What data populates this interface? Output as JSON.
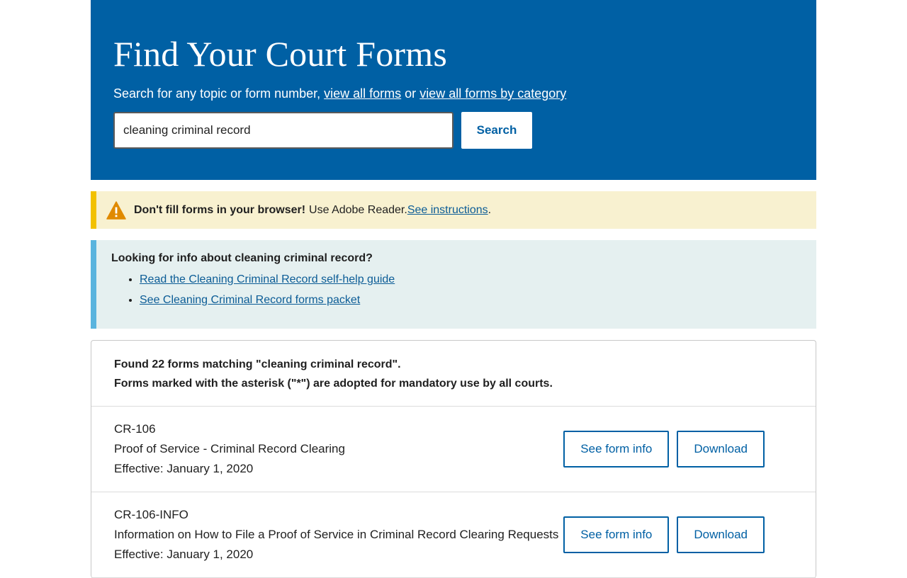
{
  "hero": {
    "title": "Find Your Court Forms",
    "subtitle_text": "Search for any topic or form number, ",
    "link_all_forms": "view all forms",
    "or_text": " or ",
    "link_by_category": "view all forms by category",
    "search_value": "cleaning criminal record",
    "search_button": "Search"
  },
  "alert": {
    "icon": "warning-icon",
    "bold": "Don't fill forms in your browser!",
    "text": "Use Adobe Reader. ",
    "link": "See instructions",
    "end": ".",
    "accent": "#f2c100"
  },
  "info": {
    "question": "Looking for info about cleaning criminal record?",
    "links": [
      "Read the Cleaning Criminal Record self-help guide",
      "See Cleaning Criminal Record forms packet"
    ]
  },
  "results": {
    "summary": "Found 22 forms matching \"cleaning criminal record\".",
    "note": "Forms marked with the asterisk (\"*\") are adopted for mandatory use by all courts.",
    "items": [
      {
        "code": "CR-106",
        "title": "Proof of Service - Criminal Record Clearing",
        "effective": "Effective: January 1, 2020",
        "info_button": "See form info",
        "download_button": "Download"
      },
      {
        "code": "CR-106-INFO",
        "title": "Information on How to File a Proof of Service in Criminal Record Clearing Requests",
        "effective": "Effective: January 1, 2020",
        "info_button": "See form info",
        "download_button": "Download"
      }
    ]
  },
  "colors": {
    "brand": "#0060a4",
    "info_accent": "#5ab4de"
  }
}
